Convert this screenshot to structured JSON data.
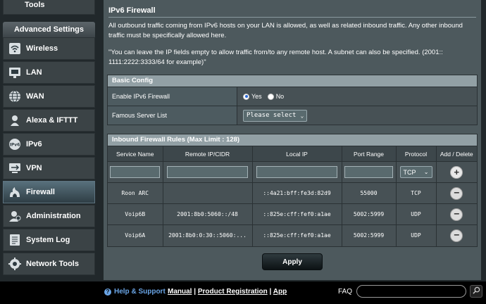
{
  "sidebar": {
    "tools_label": "Tools",
    "section_title": "Advanced Settings",
    "items": [
      {
        "label": "Wireless",
        "icon": "wifi-icon"
      },
      {
        "label": "LAN",
        "icon": "lan-icon"
      },
      {
        "label": "WAN",
        "icon": "globe-icon"
      },
      {
        "label": "Alexa & IFTTT",
        "icon": "alexa-icon"
      },
      {
        "label": "IPv6",
        "icon": "ipv6-icon"
      },
      {
        "label": "VPN",
        "icon": "vpn-icon"
      },
      {
        "label": "Firewall",
        "icon": "firewall-icon"
      },
      {
        "label": "Administration",
        "icon": "admin-icon"
      },
      {
        "label": "System Log",
        "icon": "log-icon"
      },
      {
        "label": "Network Tools",
        "icon": "network-tools-icon"
      }
    ],
    "active": "Firewall"
  },
  "page": {
    "title": "IPv6 Firewall",
    "desc1": "All outbound traffic coming from IPv6 hosts on your LAN is allowed, as well as related inbound traffic. Any other inbound traffic must be specifically allowed here.",
    "desc2": "\"You can leave the IP fields empty to allow traffic from/to any remote host. A subnet can also be specified. (2001:: 1111:2222:3333/64 for example)\""
  },
  "basic_config": {
    "header": "Basic Config",
    "enable_label": "Enable IPv6 Firewall",
    "yes_label": "Yes",
    "no_label": "No",
    "famous_label": "Famous Server List",
    "famous_value": "Please select"
  },
  "rules": {
    "header": "Inbound Firewall Rules (Max Limit : 128)",
    "columns": [
      "Service Name",
      "Remote IP/CIDR",
      "Local IP",
      "Port Range",
      "Protocol",
      "Add / Delete"
    ],
    "new_protocol": "TCP",
    "rows": [
      {
        "service": "Roon ARC",
        "remote": "",
        "local": "::4a21:bff:fe3d:82d9",
        "port": "55000",
        "protocol": "TCP"
      },
      {
        "service": "Voip6B",
        "remote": "2001:8b0:5060::/48",
        "local": "::825e:cff:fef0:a1ae",
        "port": "5002:5999",
        "protocol": "UDP"
      },
      {
        "service": "Voip6A",
        "remote": "2001:8b0:0:30::5060:...",
        "local": "::825e:cff:fef0:a1ae",
        "port": "5002:5999",
        "protocol": "UDP"
      }
    ]
  },
  "apply_label": "Apply",
  "footer": {
    "help": "Help & Support",
    "manual": "Manual",
    "sep": "|",
    "product_reg": "Product Registration",
    "app": "App",
    "faq": "FAQ"
  }
}
